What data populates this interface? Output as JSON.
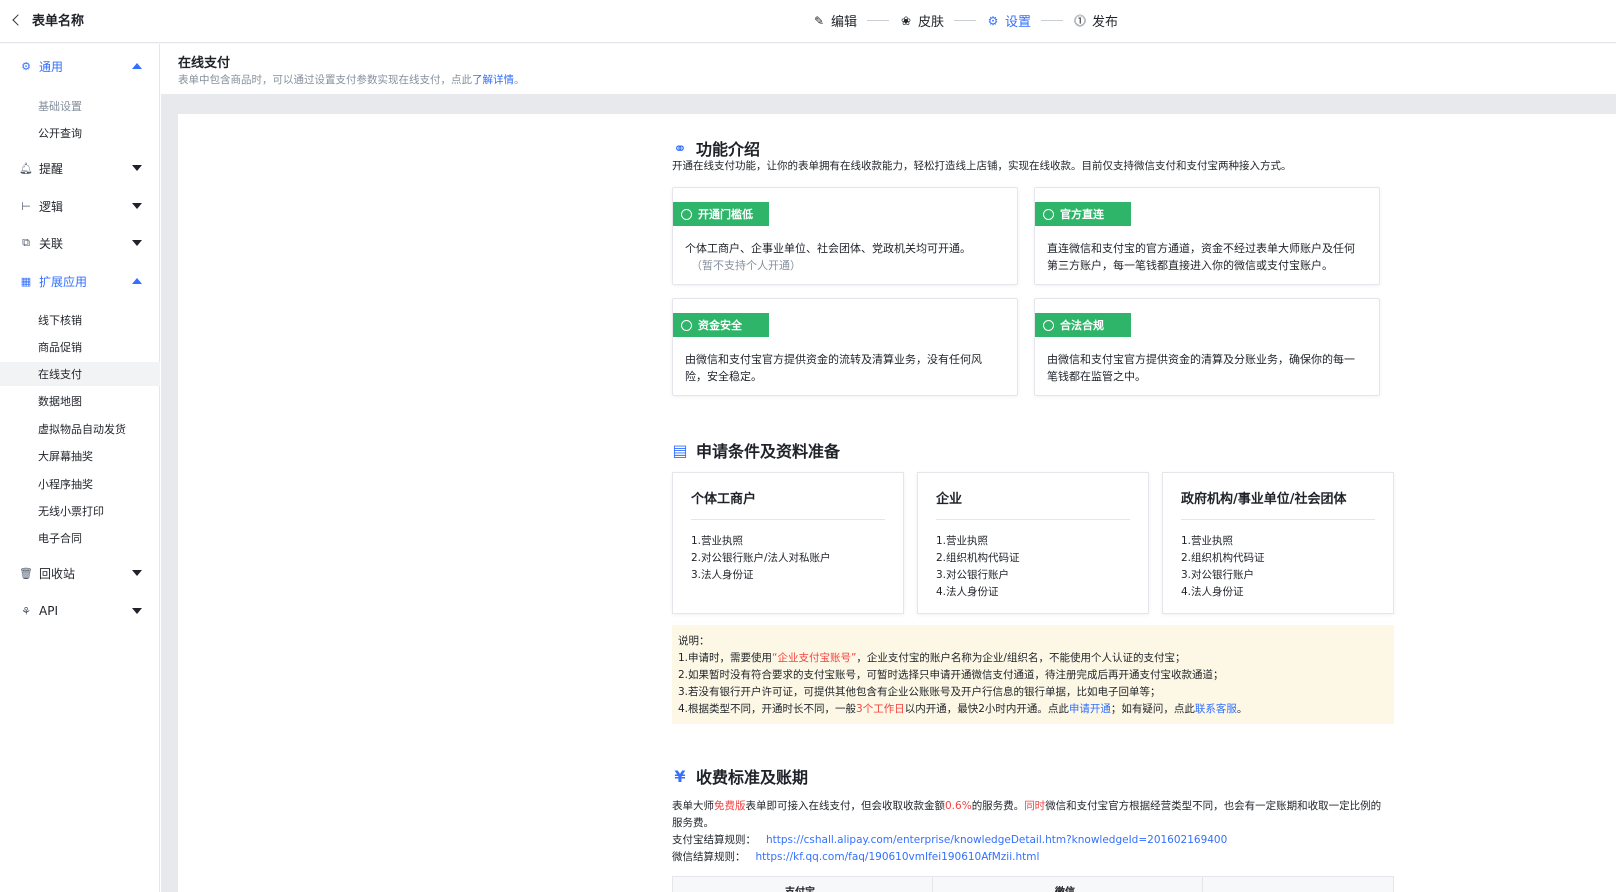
{
  "topbar": {
    "back_label": "表单名称",
    "steps": [
      {
        "label": "编辑",
        "icon": "pen-icon"
      },
      {
        "label": "皮肤",
        "icon": "palette-icon"
      },
      {
        "label": "设置",
        "icon": "gear-icon",
        "active": true
      },
      {
        "label": "发布",
        "icon": "publish-icon"
      }
    ]
  },
  "sidebar": {
    "groups": {
      "general": "通用",
      "remind": "提醒",
      "logic": "逻辑",
      "relation": "关联",
      "extend": "扩展应用",
      "recycle": "回收站",
      "api": "API"
    },
    "general_items": [
      "基础设置",
      "公开查询"
    ],
    "extend_items": [
      "线下核销",
      "商品促销",
      "在线支付",
      "数据地图",
      "虚拟物品自动发货",
      "大屏幕抽奖",
      "小程序抽奖",
      "无线小票打印",
      "电子合同"
    ]
  },
  "page": {
    "title": "在线支付",
    "subtitle_prefix": "表单中包含商品时，可以通过设置支付参数实现在线支付，点此",
    "subtitle_link": "了解详情",
    "subtitle_suffix": "。"
  },
  "intro": {
    "title": "功能介绍",
    "desc": "开通在线支付功能，让你的表单拥有在线收款能力，轻松打造线上店铺，实现在线收款。目前仅支持微信支付和支付宝两种接入方式。",
    "cards": [
      {
        "badge": "开通门槛低",
        "text": "个体工商户、企事业单位、社会团体、党政机关均可开通。",
        "note": "（暂不支持个人开通）"
      },
      {
        "badge": "官方直连",
        "text": "直连微信和支付宝的官方通道，资金不经过表单大师账户及任何第三方账户，每一笔钱都直接进入你的微信或支付宝账户。"
      },
      {
        "badge": "资金安全",
        "text": "由微信和支付宝官方提供资金的流转及清算业务，没有任何风险，安全稳定。"
      },
      {
        "badge": "合法合规",
        "text": "由微信和支付宝官方提供资金的清算及分账业务，确保你的每一笔钱都在监管之中。"
      }
    ]
  },
  "requirements": {
    "title": "申请条件及资料准备",
    "cards": [
      {
        "title": "个体工商户",
        "items": [
          "1.营业执照",
          "2.对公银行账户/法人对私账户",
          "3.法人身份证"
        ]
      },
      {
        "title": "企业",
        "items": [
          "1.营业执照",
          "2.组织机构代码证",
          "3.对公银行账户",
          "4.法人身份证"
        ]
      },
      {
        "title": "政府机构/事业单位/社会团体",
        "items": [
          "1.营业执照",
          "2.组织机构代码证",
          "3.对公银行账户",
          "4.法人身份证"
        ]
      }
    ]
  },
  "notes": {
    "heading": "说明：",
    "l1a": "1.申请时，需要使用",
    "l1b": "“企业支付宝账号”",
    "l1c": "，企业支付宝的账户名称为企业/组织名，不能使用个人认证的支付宝；",
    "l2": "2.如果暂时没有符合要求的支付宝账号，可暂时选择只申请开通微信支付通道，待注册完成后再开通支付宝收款通道；",
    "l3": "3.若没有银行开户许可证，可提供其他包含有企业公账账号及开户行信息的银行单据，比如电子回单等；",
    "l4a": "4.根据类型不同，开通时长不同，一般",
    "l4b": "3个工作日",
    "l4c": "以内开通，最快2小时内开通。点此",
    "l4d": "申请开通",
    "l4e": "；如有疑问，点此",
    "l4f": "联系客服",
    "l4g": "。"
  },
  "fees": {
    "title": "收费标准及账期",
    "p1a": "表单大师",
    "p1b": "免费版",
    "p1c": "表单即可接入在线支付，但会收取收款金额",
    "p1d": "0.6%",
    "p1e": "的服务费。",
    "p1f": "同时",
    "p1g": "微信和支付宝官方根据经营类型不同，也会有一定账期和收取一定比例的服务费。",
    "alipay_label": "支付宝结算规则：",
    "alipay_url": "https://cshall.alipay.com/enterprise/knowledgeDetail.htm?knowledgeId=201602169400",
    "wechat_label": "微信结算规则：",
    "wechat_url": "https://kf.qq.com/faq/190610vmIfei190610AfMzii.html",
    "table_headers": [
      "支付宝",
      "微信"
    ]
  },
  "colors": {
    "accent": "#3370ff",
    "badge_green": "#2fb56a",
    "note_bg": "#fdf8e6",
    "red": "#f53f3f"
  }
}
